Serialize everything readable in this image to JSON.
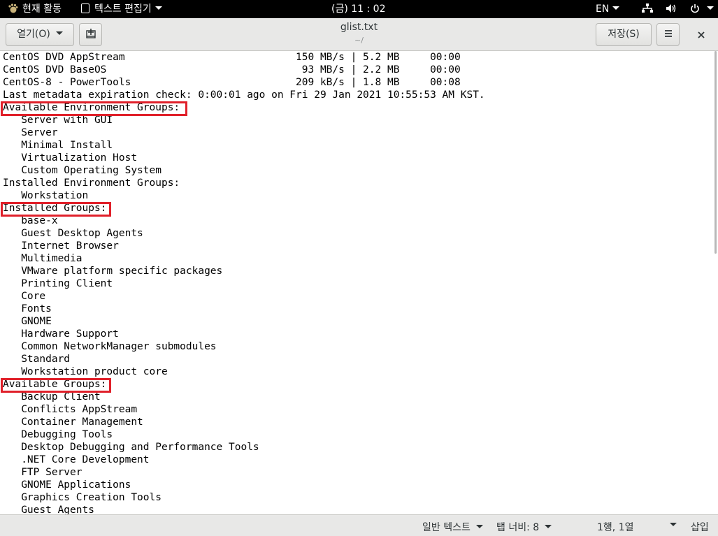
{
  "topbar": {
    "activities": "현재 활동",
    "app_menu": "텍스트 편집기",
    "clock": "(금) 11 : 02",
    "language": "EN"
  },
  "header": {
    "open_label": "열기(O)",
    "title": "glist.txt",
    "subtitle": "~/",
    "save_label": "저장(S)",
    "menu_icon": "hamburger-icon",
    "close_icon": "close-icon"
  },
  "editor": {
    "lines": [
      "CentOS DVD AppStream                            150 MB/s | 5.2 MB     00:00",
      "CentOS DVD BaseOS                                93 MB/s | 2.2 MB     00:00",
      "CentOS-8 - PowerTools                           209 kB/s | 1.8 MB     00:08",
      "Last metadata expiration check: 0:00:01 ago on Fri 29 Jan 2021 10:55:53 AM KST.",
      "Available Environment Groups:",
      "   Server with GUI",
      "   Server",
      "   Minimal Install",
      "   Virtualization Host",
      "   Custom Operating System",
      "Installed Environment Groups:",
      "   Workstation",
      "Installed Groups:",
      "   base-x",
      "   Guest Desktop Agents",
      "   Internet Browser",
      "   Multimedia",
      "   VMware platform specific packages",
      "   Printing Client",
      "   Core",
      "   Fonts",
      "   GNOME",
      "   Hardware Support",
      "   Common NetworkManager submodules",
      "   Standard",
      "   Workstation product core",
      "Available Groups:",
      "   Backup Client",
      "   Conflicts AppStream",
      "   Container Management",
      "   Debugging Tools",
      "   Desktop Debugging and Performance Tools",
      "   .NET Core Development",
      "   FTP Server",
      "   GNOME Applications",
      "   Graphics Creation Tools",
      "   Guest Agents"
    ],
    "highlight_color": "#e0202a"
  },
  "status": {
    "language_mode": "일반 텍스트",
    "tab_width": "탭 너비: 8",
    "cursor_pos": "1행, 1열",
    "insert_mode": "삽입"
  }
}
